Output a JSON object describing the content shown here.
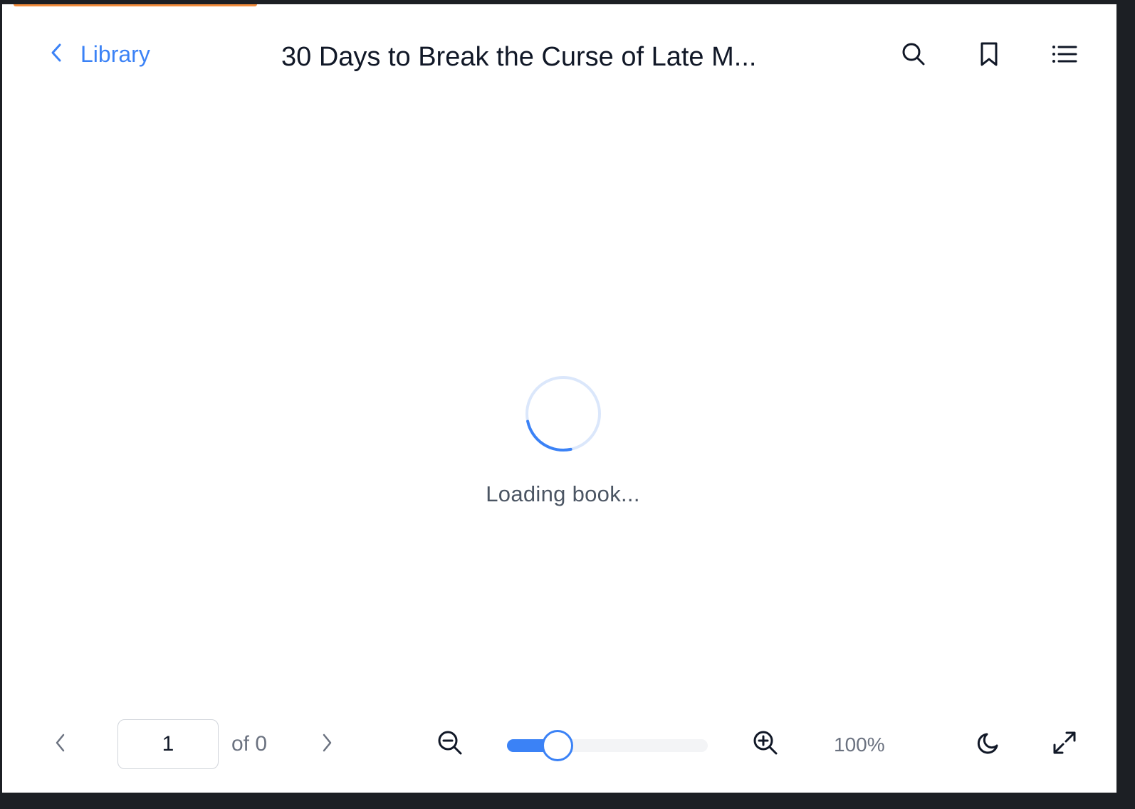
{
  "header": {
    "back_label": "Library",
    "title": "30 Days to Break the Curse of Late M...",
    "icons": [
      "search-icon",
      "bookmark-icon",
      "list-icon"
    ]
  },
  "loading": {
    "text": "Loading book..."
  },
  "footer": {
    "page_value": "1",
    "page_total": "of 0",
    "zoom_label": "100%",
    "zoom_fraction": 0.25,
    "icons": [
      "chevron-left-icon",
      "chevron-right-icon",
      "zoom-out-icon",
      "zoom-in-icon",
      "moon-icon",
      "fullscreen-icon"
    ]
  },
  "colors": {
    "accent": "#3b82f6",
    "top_accent": "#f28c3c",
    "title": "#111827",
    "muted": "#6b7280"
  }
}
